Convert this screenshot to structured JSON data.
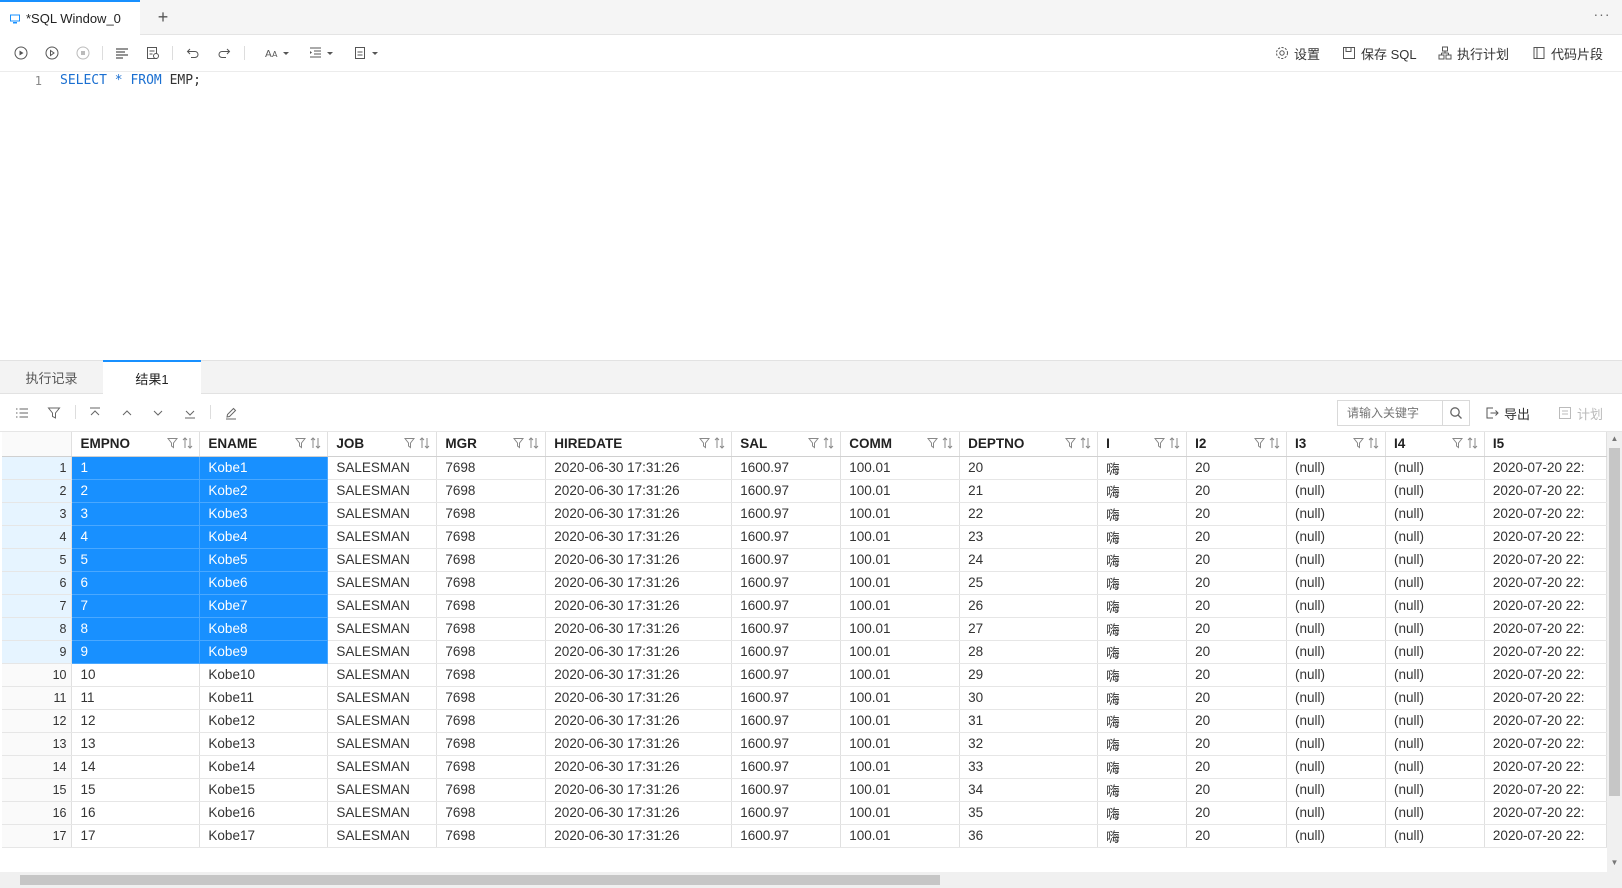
{
  "tab": {
    "title": "*SQL Window_0",
    "add": "+",
    "more": "···"
  },
  "toolbar_right": {
    "settings": "设置",
    "save_sql": "保存 SQL",
    "explain_plan": "执行计划",
    "snippets": "代码片段"
  },
  "editor": {
    "line_number": "1",
    "select_kw": "SELECT",
    "star": "*",
    "from_kw": "FROM",
    "rest": "EMP;"
  },
  "result_tabs": {
    "history": "执行记录",
    "result": "结果1"
  },
  "result_toolbar": {
    "search_placeholder": "请输入关键字",
    "export": "导出",
    "plan": "计划"
  },
  "grid": {
    "columns": [
      "EMPNO",
      "ENAME",
      "JOB",
      "MGR",
      "HIREDATE",
      "SAL",
      "COMM",
      "DEPTNO",
      "I",
      "I2",
      "I3",
      "I4",
      "I5"
    ],
    "rows": [
      [
        "1",
        "1",
        "Kobe1",
        "SALESMAN",
        "7698",
        "2020-06-30 17:31:26",
        "1600.97",
        "100.01",
        "20",
        "嗨",
        "20",
        "(null)",
        "(null)",
        "2020-07-20 22:"
      ],
      [
        "2",
        "2",
        "Kobe2",
        "SALESMAN",
        "7698",
        "2020-06-30 17:31:26",
        "1600.97",
        "100.01",
        "21",
        "嗨",
        "20",
        "(null)",
        "(null)",
        "2020-07-20 22:"
      ],
      [
        "3",
        "3",
        "Kobe3",
        "SALESMAN",
        "7698",
        "2020-06-30 17:31:26",
        "1600.97",
        "100.01",
        "22",
        "嗨",
        "20",
        "(null)",
        "(null)",
        "2020-07-20 22:"
      ],
      [
        "4",
        "4",
        "Kobe4",
        "SALESMAN",
        "7698",
        "2020-06-30 17:31:26",
        "1600.97",
        "100.01",
        "23",
        "嗨",
        "20",
        "(null)",
        "(null)",
        "2020-07-20 22:"
      ],
      [
        "5",
        "5",
        "Kobe5",
        "SALESMAN",
        "7698",
        "2020-06-30 17:31:26",
        "1600.97",
        "100.01",
        "24",
        "嗨",
        "20",
        "(null)",
        "(null)",
        "2020-07-20 22:"
      ],
      [
        "6",
        "6",
        "Kobe6",
        "SALESMAN",
        "7698",
        "2020-06-30 17:31:26",
        "1600.97",
        "100.01",
        "25",
        "嗨",
        "20",
        "(null)",
        "(null)",
        "2020-07-20 22:"
      ],
      [
        "7",
        "7",
        "Kobe7",
        "SALESMAN",
        "7698",
        "2020-06-30 17:31:26",
        "1600.97",
        "100.01",
        "26",
        "嗨",
        "20",
        "(null)",
        "(null)",
        "2020-07-20 22:"
      ],
      [
        "8",
        "8",
        "Kobe8",
        "SALESMAN",
        "7698",
        "2020-06-30 17:31:26",
        "1600.97",
        "100.01",
        "27",
        "嗨",
        "20",
        "(null)",
        "(null)",
        "2020-07-20 22:"
      ],
      [
        "9",
        "9",
        "Kobe9",
        "SALESMAN",
        "7698",
        "2020-06-30 17:31:26",
        "1600.97",
        "100.01",
        "28",
        "嗨",
        "20",
        "(null)",
        "(null)",
        "2020-07-20 22:"
      ],
      [
        "10",
        "10",
        "Kobe10",
        "SALESMAN",
        "7698",
        "2020-06-30 17:31:26",
        "1600.97",
        "100.01",
        "29",
        "嗨",
        "20",
        "(null)",
        "(null)",
        "2020-07-20 22:"
      ],
      [
        "11",
        "11",
        "Kobe11",
        "SALESMAN",
        "7698",
        "2020-06-30 17:31:26",
        "1600.97",
        "100.01",
        "30",
        "嗨",
        "20",
        "(null)",
        "(null)",
        "2020-07-20 22:"
      ],
      [
        "12",
        "12",
        "Kobe12",
        "SALESMAN",
        "7698",
        "2020-06-30 17:31:26",
        "1600.97",
        "100.01",
        "31",
        "嗨",
        "20",
        "(null)",
        "(null)",
        "2020-07-20 22:"
      ],
      [
        "13",
        "13",
        "Kobe13",
        "SALESMAN",
        "7698",
        "2020-06-30 17:31:26",
        "1600.97",
        "100.01",
        "32",
        "嗨",
        "20",
        "(null)",
        "(null)",
        "2020-07-20 22:"
      ],
      [
        "14",
        "14",
        "Kobe14",
        "SALESMAN",
        "7698",
        "2020-06-30 17:31:26",
        "1600.97",
        "100.01",
        "33",
        "嗨",
        "20",
        "(null)",
        "(null)",
        "2020-07-20 22:"
      ],
      [
        "15",
        "15",
        "Kobe15",
        "SALESMAN",
        "7698",
        "2020-06-30 17:31:26",
        "1600.97",
        "100.01",
        "34",
        "嗨",
        "20",
        "(null)",
        "(null)",
        "2020-07-20 22:"
      ],
      [
        "16",
        "16",
        "Kobe16",
        "SALESMAN",
        "7698",
        "2020-06-30 17:31:26",
        "1600.97",
        "100.01",
        "35",
        "嗨",
        "20",
        "(null)",
        "(null)",
        "2020-07-20 22:"
      ],
      [
        "17",
        "17",
        "Kobe17",
        "SALESMAN",
        "7698",
        "2020-06-30 17:31:26",
        "1600.97",
        "100.01",
        "36",
        "嗨",
        "20",
        "(null)",
        "(null)",
        "2020-07-20 22:"
      ]
    ],
    "selected_rows": 9,
    "selected_columns": [
      "EMPNO",
      "ENAME"
    ]
  },
  "colors": {
    "accent": "#1890ff",
    "keyword": "#1a6fd1",
    "selection_rowhead": "#e6f4ff"
  },
  "icons": {
    "toolbar": [
      "run-icon",
      "run-current-icon",
      "stop-icon",
      "format-icon",
      "explain-icon",
      "undo-icon",
      "redo-icon",
      "case-icon",
      "indent-icon",
      "comment-icon"
    ],
    "result_toolbar": [
      "list-icon",
      "filter-icon",
      "first-row-icon",
      "prev-row-icon",
      "next-row-icon",
      "last-row-icon",
      "edit-icon",
      "search-icon",
      "export-icon",
      "plan-icon"
    ]
  }
}
